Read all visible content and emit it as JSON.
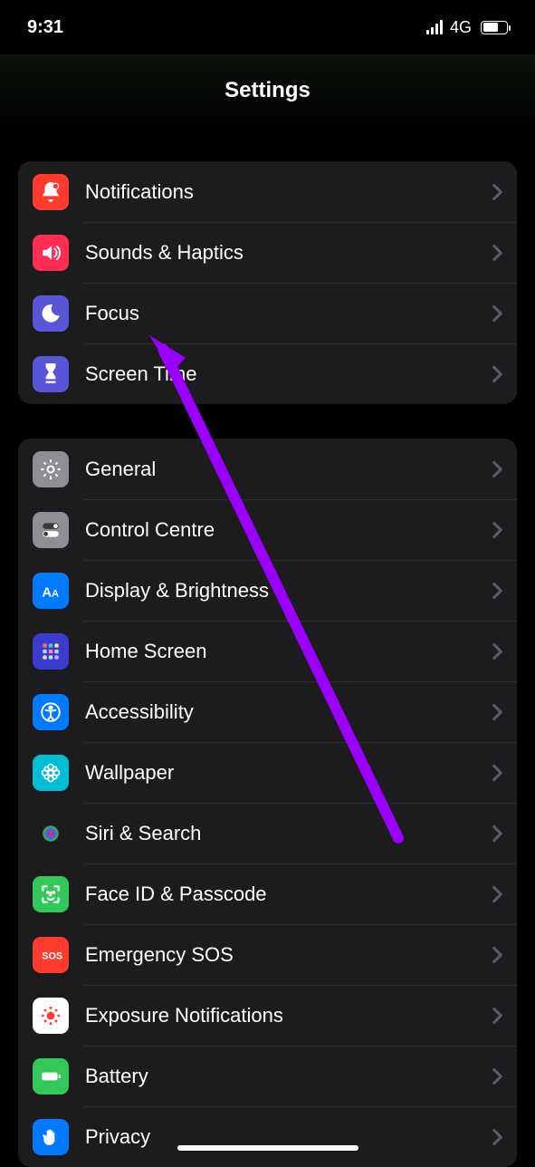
{
  "status": {
    "time": "9:31",
    "network": "4G"
  },
  "header": {
    "title": "Settings"
  },
  "groups": [
    {
      "items": [
        {
          "id": "notifications",
          "label": "Notifications",
          "icon": "bell",
          "bg": "#ff3b30"
        },
        {
          "id": "sounds",
          "label": "Sounds & Haptics",
          "icon": "speaker",
          "bg": "#ff2d55"
        },
        {
          "id": "focus",
          "label": "Focus",
          "icon": "moon",
          "bg": "#5856d6"
        },
        {
          "id": "screentime",
          "label": "Screen Time",
          "icon": "hourglass",
          "bg": "#5856d6"
        }
      ]
    },
    {
      "items": [
        {
          "id": "general",
          "label": "General",
          "icon": "gear",
          "bg": "#8e8e93"
        },
        {
          "id": "controlcentre",
          "label": "Control Centre",
          "icon": "toggles",
          "bg": "#8e8e93"
        },
        {
          "id": "display",
          "label": "Display & Brightness",
          "icon": "aa",
          "bg": "#007aff"
        },
        {
          "id": "homescreen",
          "label": "Home Screen",
          "icon": "grid",
          "bg": "#3a3bcf"
        },
        {
          "id": "accessibility",
          "label": "Accessibility",
          "icon": "person",
          "bg": "#007aff"
        },
        {
          "id": "wallpaper",
          "label": "Wallpaper",
          "icon": "flower",
          "bg": "#00bcd4"
        },
        {
          "id": "siri",
          "label": "Siri & Search",
          "icon": "siri",
          "bg": "#1c1c1e"
        },
        {
          "id": "faceid",
          "label": "Face ID & Passcode",
          "icon": "faceid",
          "bg": "#34c759"
        },
        {
          "id": "sos",
          "label": "Emergency SOS",
          "icon": "sos",
          "bg": "#ff3b30"
        },
        {
          "id": "exposure",
          "label": "Exposure Notifications",
          "icon": "exposure",
          "bg": "#ffffff"
        },
        {
          "id": "battery",
          "label": "Battery",
          "icon": "battery",
          "bg": "#34c759"
        },
        {
          "id": "privacy",
          "label": "Privacy",
          "icon": "hand",
          "bg": "#007aff"
        }
      ]
    }
  ],
  "annotation": {
    "arrow_color": "#9b00ff"
  }
}
